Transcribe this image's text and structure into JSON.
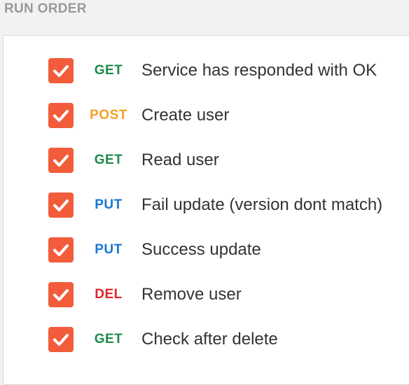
{
  "header": {
    "title": "RUN ORDER"
  },
  "colors": {
    "checkbox": "#f25c3a",
    "GET": "#1d8a4a",
    "POST": "#f4a023",
    "PUT": "#1976d2",
    "DEL": "#e0242b"
  },
  "requests": [
    {
      "checked": true,
      "method": "GET",
      "name": "Service has responded with OK"
    },
    {
      "checked": true,
      "method": "POST",
      "name": "Create user"
    },
    {
      "checked": true,
      "method": "GET",
      "name": "Read user"
    },
    {
      "checked": true,
      "method": "PUT",
      "name": "Fail update (version dont match)"
    },
    {
      "checked": true,
      "method": "PUT",
      "name": "Success update"
    },
    {
      "checked": true,
      "method": "DEL",
      "name": "Remove user"
    },
    {
      "checked": true,
      "method": "GET",
      "name": "Check after delete"
    }
  ]
}
